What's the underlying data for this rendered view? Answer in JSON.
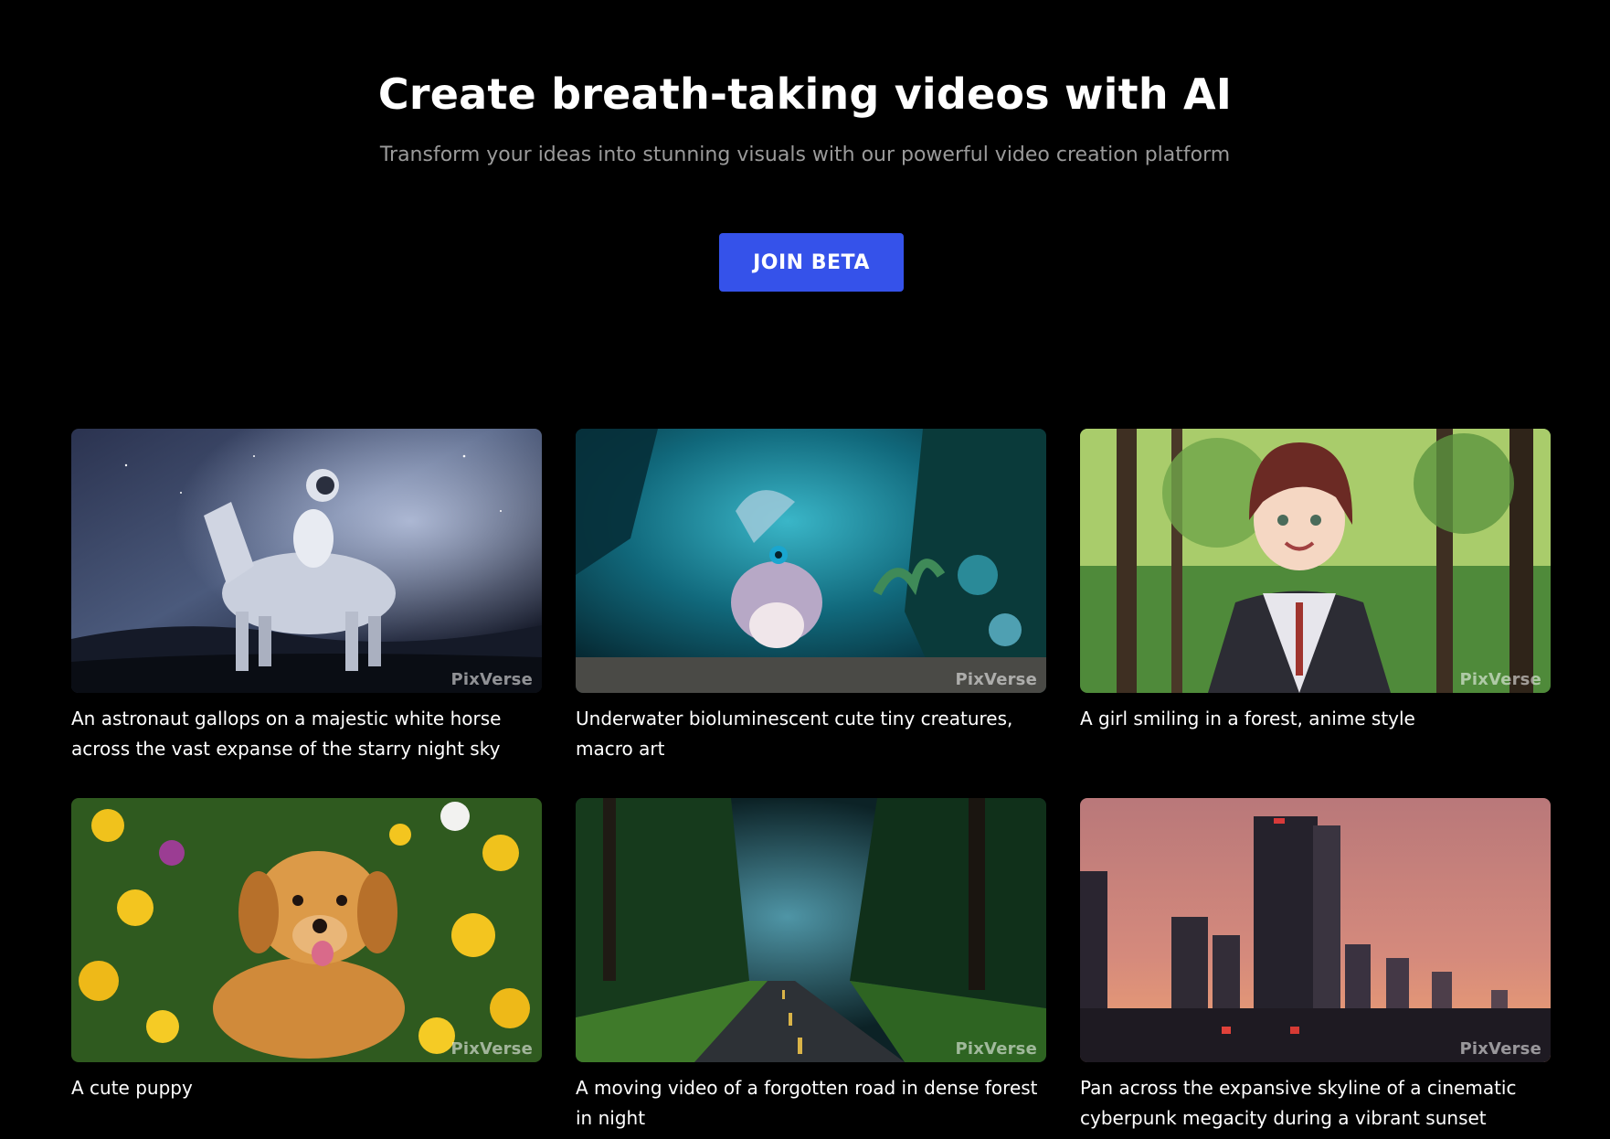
{
  "hero": {
    "title": "Create breath-taking videos with AI",
    "subtitle": "Transform your ideas into stunning visuals with our powerful video creation platform",
    "cta_label": "JOIN BETA"
  },
  "colors": {
    "background": "#000000",
    "accent": "#3552ea",
    "subtitle": "#9a9a9a"
  },
  "gallery": {
    "watermark": "PixVerse",
    "items": [
      {
        "caption": "An astronaut gallops on a majestic white horse across the vast expanse of the starry night sky",
        "scene": "astronaut-horse-night-sky"
      },
      {
        "caption": "Underwater bioluminescent cute tiny creatures, macro art",
        "scene": "underwater-creature"
      },
      {
        "caption": "A girl smiling in a forest, anime style",
        "scene": "anime-girl-forest"
      },
      {
        "caption": "A cute puppy",
        "scene": "puppy-flowers"
      },
      {
        "caption": "A moving video of a forgotten road in dense forest in night",
        "scene": "forest-road-night"
      },
      {
        "caption": "Pan across the expansive skyline of a cinematic cyberpunk megacity during a vibrant sunset",
        "scene": "cyberpunk-city-sunset"
      }
    ]
  }
}
